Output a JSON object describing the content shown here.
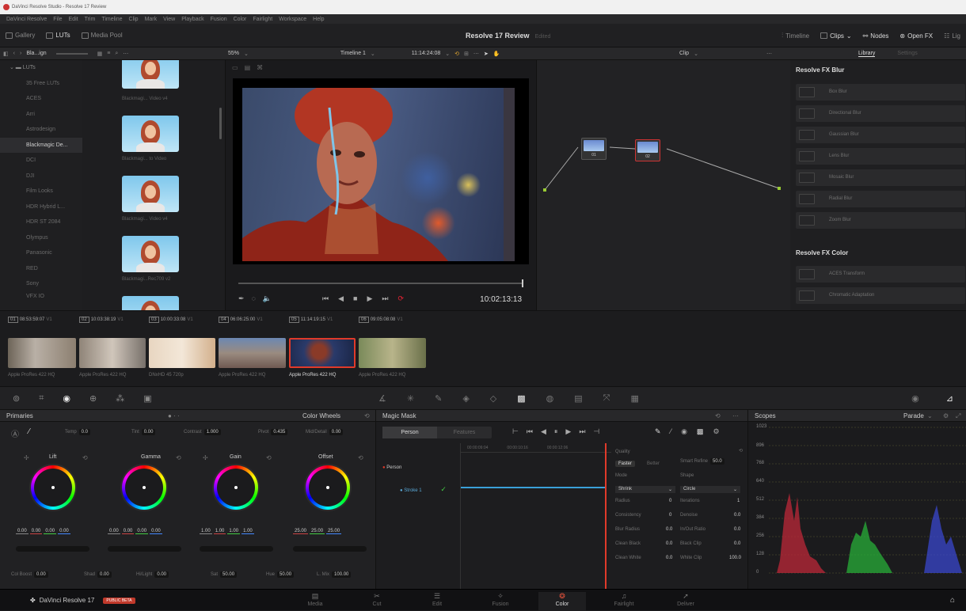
{
  "window": {
    "title": "DaVinci Resolve Studio - Resolve 17 Review"
  },
  "menu": [
    "DaVinci Resolve",
    "File",
    "Edit",
    "Trim",
    "Timeline",
    "Clip",
    "Mark",
    "View",
    "Playback",
    "Fusion",
    "Color",
    "Fairlight",
    "Workspace",
    "Help"
  ],
  "toolbar": {
    "gallery": "Gallery",
    "luts": "LUTs",
    "media_pool": "Media Pool",
    "project": "Resolve 17 Review",
    "status": "Edited",
    "timeline": "Timeline",
    "clips": "Clips",
    "nodes": "Nodes",
    "openfx": "Open FX",
    "lightbox": "Lig"
  },
  "subbar": {
    "folder": "Bla...ign",
    "zoom": "55%",
    "timeline": "Timeline 1",
    "timecode": "11:14:24:08",
    "clip": "Clip",
    "library": "Library",
    "settings": "Settings"
  },
  "luts": {
    "root": "LUTs",
    "folders": [
      "35 Free LUTs",
      "ACES",
      "Arri",
      "Astrodesign",
      "Blackmagic De...",
      "DCI",
      "DJI",
      "Film Looks",
      "HDR Hybrid L...",
      "HDR ST 2084",
      "Olympus",
      "Panasonic",
      "RED",
      "Sony",
      "VFX IO"
    ],
    "selected_index": 4,
    "thumb_labels": [
      "Blackmagi... Video v4",
      "Blackmagi... to Video",
      "Blackmagi... Video v4",
      "Blackmagi...Rec709 v2"
    ]
  },
  "viewer": {
    "timecode": "10:02:13:13"
  },
  "nodes": [
    {
      "label": "01"
    },
    {
      "label": "02"
    }
  ],
  "library": {
    "blur_title": "Resolve FX Blur",
    "blur_items": [
      "Box Blur",
      "Directional Blur",
      "Gaussian Blur",
      "Lens Blur",
      "Mosaic Blur",
      "Radial Blur",
      "Zoom Blur"
    ],
    "color_title": "Resolve FX Color",
    "color_items": [
      "ACES Transform",
      "Chromatic Adaptation"
    ]
  },
  "clips": [
    {
      "num": "01",
      "tc": "08:53:59:07",
      "track": "V1",
      "codec": "Apple ProRes 422 HQ"
    },
    {
      "num": "02",
      "tc": "10:03:38:19",
      "track": "V1",
      "codec": "Apple ProRes 422 HQ"
    },
    {
      "num": "03",
      "tc": "10:00:33:08",
      "track": "V1",
      "codec": "DNxHD 45 720p"
    },
    {
      "num": "04",
      "tc": "06:06:25:00",
      "track": "V1",
      "codec": "Apple ProRes 422 HQ"
    },
    {
      "num": "05",
      "tc": "11:14:19:15",
      "track": "V1",
      "codec": "Apple ProRes 422 HQ"
    },
    {
      "num": "06",
      "tc": "09:05:08:08",
      "track": "V1",
      "codec": "Apple ProRes 422 HQ"
    }
  ],
  "primaries": {
    "title": "Primaries",
    "mode": "Color Wheels",
    "temp_label": "Temp",
    "temp": "0.0",
    "tint_label": "Tint",
    "tint": "0.00",
    "contrast_label": "Contrast",
    "contrast": "1.000",
    "pivot_label": "Pivot",
    "pivot": "0.435",
    "middetail_label": "Mid/Detail",
    "middetail": "0.00",
    "wheels": [
      {
        "name": "Lift",
        "vals": [
          "0.00",
          "0.00",
          "0.00",
          "0.00"
        ]
      },
      {
        "name": "Gamma",
        "vals": [
          "0.00",
          "0.00",
          "0.00",
          "0.00"
        ]
      },
      {
        "name": "Gain",
        "vals": [
          "1.00",
          "1.00",
          "1.00",
          "1.00"
        ]
      },
      {
        "name": "Offset",
        "vals": [
          "25.00",
          "25.00",
          "25.00"
        ]
      }
    ],
    "colboost_label": "Col Boost",
    "colboost": "0.00",
    "shad_label": "Shad",
    "shad": "0.00",
    "hilight_label": "Hi/Light",
    "hilight": "0.00",
    "sat_label": "Sat",
    "sat": "50.00",
    "hue_label": "Hue",
    "hue": "50.00",
    "lmix_label": "L. Mix",
    "lmix": "100.00"
  },
  "magic_mask": {
    "title": "Magic Mask",
    "tab_person": "Person",
    "tab_features": "Features",
    "ruler": [
      "00:00:09:04",
      "00:00:10:16",
      "00:00:12:06"
    ],
    "layer": "Person",
    "stroke": "Stroke 1",
    "quality_label": "Quality",
    "faster": "Faster",
    "better": "Better",
    "smart_refine_label": "Smart Refine",
    "smart_refine": "50.0",
    "mode_label": "Mode",
    "mode": "Shrink",
    "shape_label": "Shape",
    "shape": "Circle",
    "radius_label": "Radius",
    "radius": "0",
    "iterations_label": "Iterations",
    "iterations": "1",
    "consistency_label": "Consistency",
    "consistency": "0",
    "denoise_label": "Denoise",
    "denoise": "0.0",
    "blur_radius_label": "Blur Radius",
    "blur_radius": "0.0",
    "inout_label": "In/Out Ratio",
    "inout": "0.0",
    "clean_black_label": "Clean Black",
    "clean_black": "0.0",
    "black_clip_label": "Black Clip",
    "black_clip": "0.0",
    "clean_white_label": "Clean White",
    "clean_white": "0.0",
    "white_clip_label": "White Clip",
    "white_clip": "100.0"
  },
  "scopes": {
    "title": "Scopes",
    "mode": "Parade",
    "scale": [
      "1023",
      "896",
      "768",
      "640",
      "512",
      "384",
      "256",
      "128",
      "0"
    ]
  },
  "bottom": {
    "app": "DaVinci Resolve 17",
    "beta": "PUBLIC BETA",
    "pages": [
      "Media",
      "Cut",
      "Edit",
      "Fusion",
      "Color",
      "Fairlight",
      "Deliver"
    ],
    "active_page": "Color"
  }
}
